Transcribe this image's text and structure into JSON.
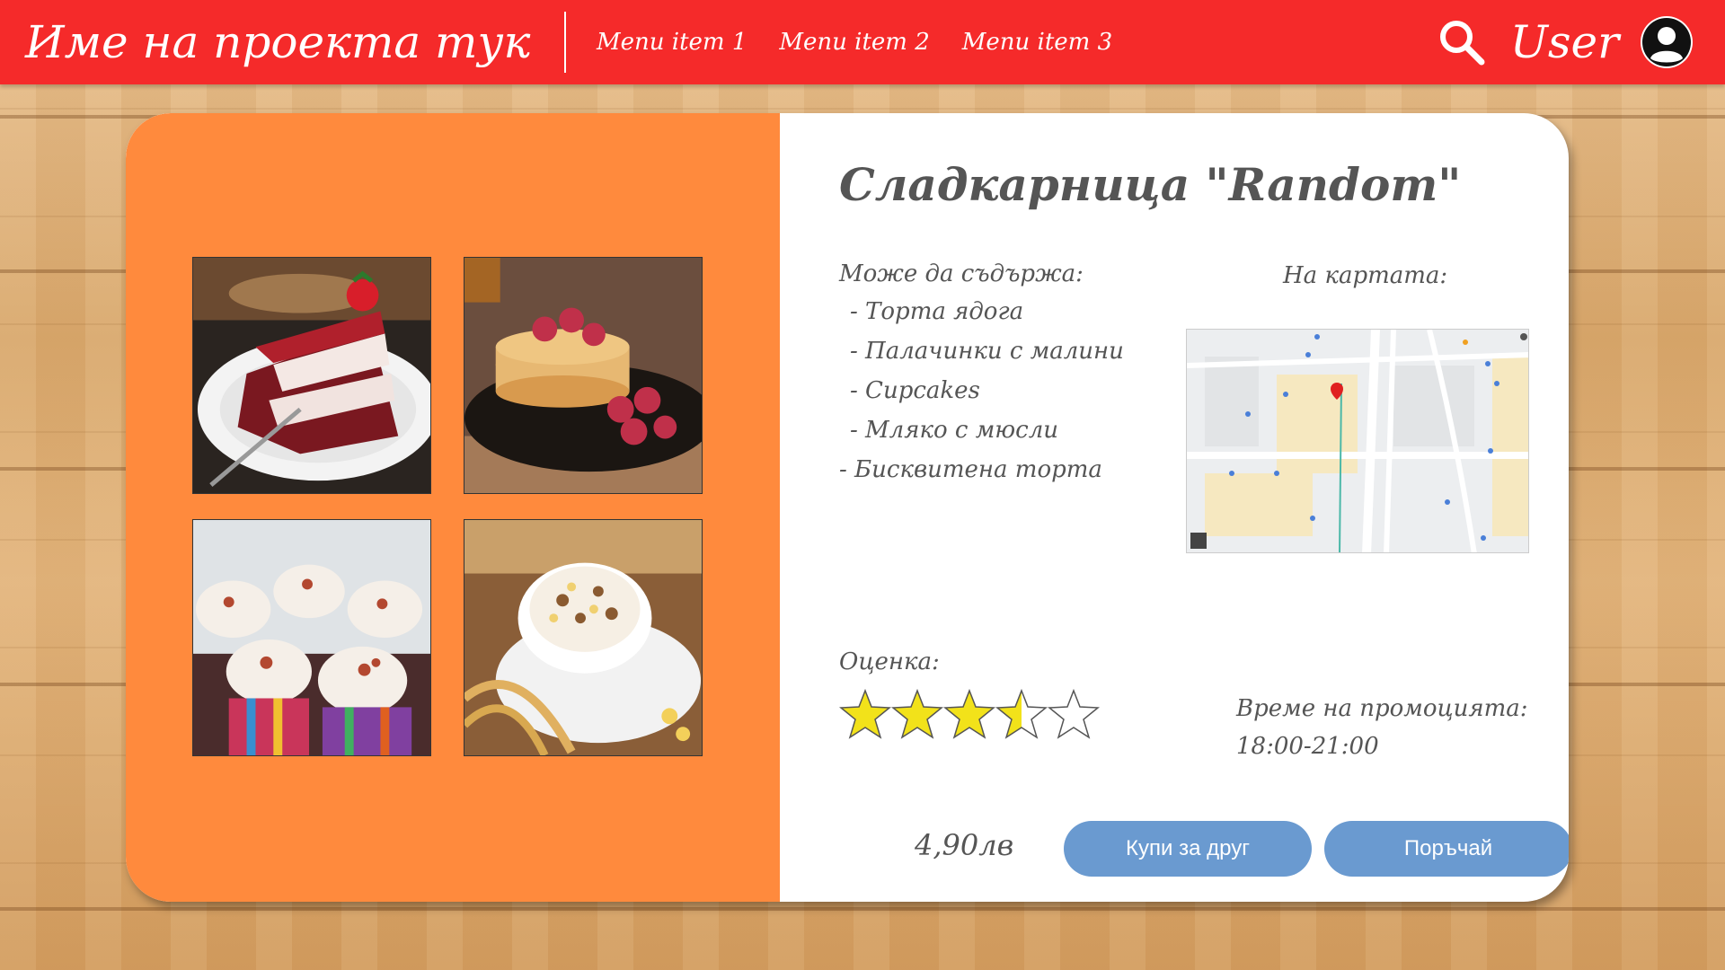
{
  "header": {
    "brand": "Име на проекта тук",
    "menu": [
      "Menu item 1",
      "Menu item 2",
      "Menu item 3"
    ],
    "user_label": "User"
  },
  "product": {
    "title": "Сладкарница \"Random\"",
    "contains_label": "Може да съдържа:",
    "ingredients": [
      "- Торта ядога",
      "- Палачинки с малини",
      "- Cupcakes",
      "- Мляко с мюсли",
      "- Бисквитена торта"
    ],
    "map_label": "На картата:",
    "rating_label": "Оценка:",
    "rating": 3.5,
    "rating_max": 5,
    "promo_label": "Време на промоцията:",
    "promo_time": "18:00-21:00",
    "price": "4,90лв",
    "buy_gift_label": "Купи за друг",
    "order_label": "Поръчай"
  },
  "gallery": [
    {
      "name": "red velvet cake"
    },
    {
      "name": "pancakes with raspberries"
    },
    {
      "name": "cupcakes"
    },
    {
      "name": "milk with muesli"
    }
  ],
  "colors": {
    "topbar": "#f52a2a",
    "gallery_bg": "#ff8a3d",
    "button": "#6a9ad0",
    "star_fill": "#f2e21a"
  }
}
